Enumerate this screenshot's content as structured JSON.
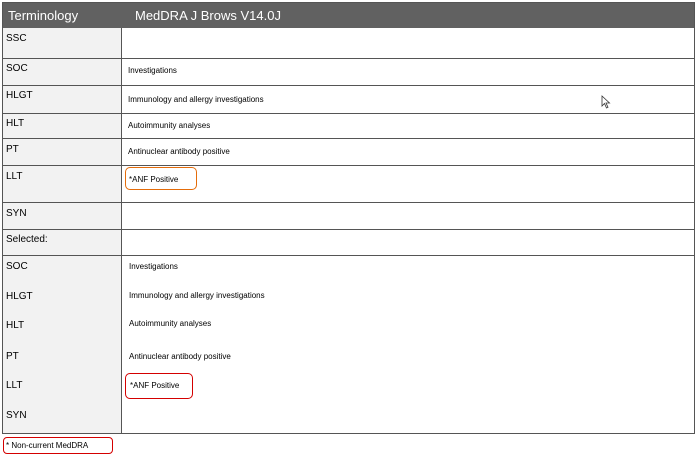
{
  "header": {
    "left_label": "Terminology",
    "right_label": "MedDRA J Brows V14.0J"
  },
  "top_rows": [
    {
      "label": "SSC",
      "value": ""
    },
    {
      "label": "SOC",
      "value": "Investigations"
    },
    {
      "label": "HLGT",
      "value": "Immunology and allergy investigations"
    },
    {
      "label": "HLT",
      "value": "Autoimmunity analyses"
    },
    {
      "label": "PT",
      "value": "Antinuclear antibody positive"
    },
    {
      "label": "LLT",
      "value": "*ANF Positive"
    },
    {
      "label": "SYN",
      "value": ""
    }
  ],
  "selected": {
    "label": "Selected:",
    "rows": [
      {
        "label": "SOC",
        "value": "Investigations"
      },
      {
        "label": "HLGT",
        "value": "Immunology and allergy investigations"
      },
      {
        "label": "HLT",
        "value": "Autoimmunity analyses"
      },
      {
        "label": "PT",
        "value": "Antinuclear antibody positive"
      },
      {
        "label": "LLT",
        "value": "*ANF Positive"
      },
      {
        "label": "SYN",
        "value": ""
      }
    ]
  },
  "footnote": "* Non-current MedDRA",
  "colors": {
    "header_bg": "#616161",
    "label_bg": "#f2f2f2",
    "highlight_orange": "#e46c0a",
    "highlight_red": "#d40000"
  },
  "icons": {
    "cursor": "mouse-pointer-icon"
  }
}
